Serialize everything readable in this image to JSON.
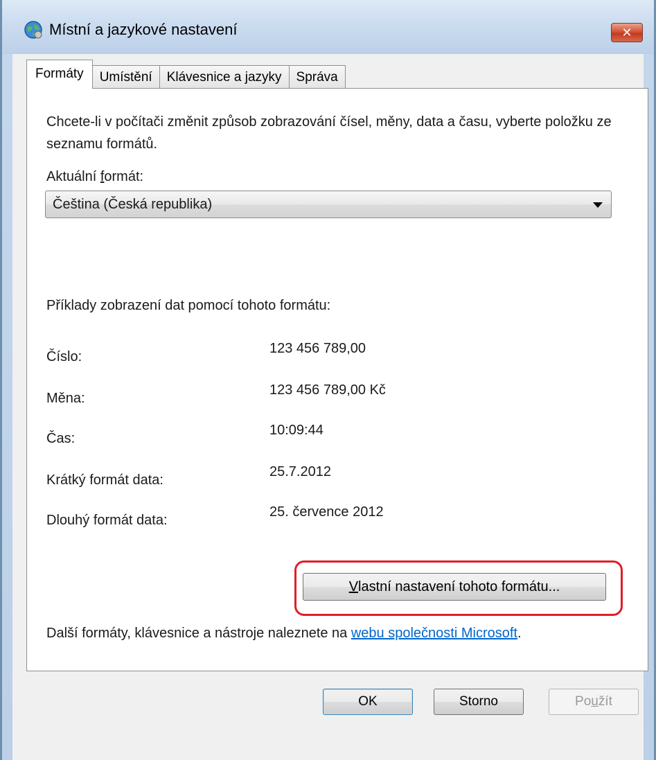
{
  "window": {
    "title": "Místní a jazykové nastavení",
    "close_glyph": "✕"
  },
  "tabs": [
    {
      "label": "Formáty",
      "active": true
    },
    {
      "label": "Umístění",
      "active": false
    },
    {
      "label": "Klávesnice a jazyky",
      "active": false
    },
    {
      "label": "Správa",
      "active": false
    }
  ],
  "formats": {
    "intro": "Chcete-li v počítači změnit způsob zobrazování čísel, měny, data a času, vyberte položku ze seznamu formátů.",
    "current_label_pre": "Aktuální ",
    "current_label_acc": "f",
    "current_label_post": "ormát:",
    "current_value": "Čeština (Česká republika)",
    "examples_heading": "Příklady zobrazení dat pomocí tohoto formátu:",
    "examples": [
      {
        "label": "Číslo:",
        "value": "123 456 789,00"
      },
      {
        "label": "Měna:",
        "value": "123 456 789,00 Kč"
      },
      {
        "label": "Čas:",
        "value": "10:09:44"
      },
      {
        "label": "Krátký formát data:",
        "value": "25.7.2012"
      },
      {
        "label": "Dlouhý formát data:",
        "value": "25. července 2012"
      }
    ],
    "custom_button_acc": "V",
    "custom_button_rest": "lastní nastavení tohoto formátu...",
    "footer_text": "Další formáty, klávesnice a nástroje naleznete na ",
    "footer_link": "webu společnosti Microsoft",
    "footer_end": "."
  },
  "buttons": {
    "ok": "OK",
    "cancel": "Storno",
    "apply_pre": "Po",
    "apply_acc": "u",
    "apply_post": "žít"
  },
  "colors": {
    "highlight": "#e01e2a",
    "link": "#0066cc"
  }
}
